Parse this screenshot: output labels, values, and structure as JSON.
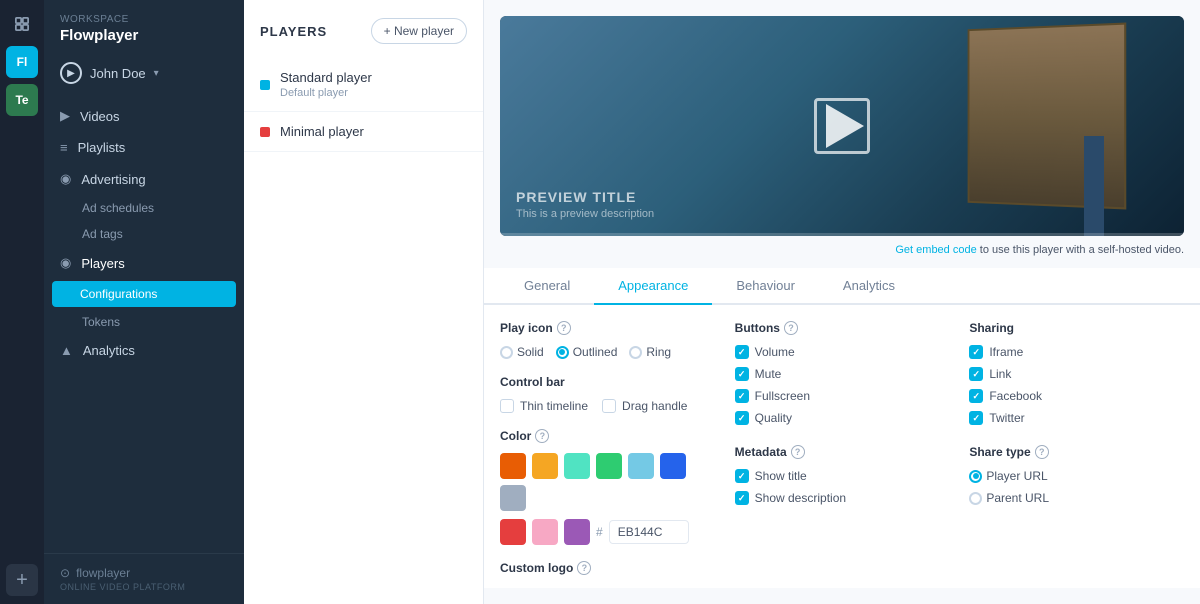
{
  "iconRail": {
    "items": [
      {
        "id": "grid",
        "label": "Grid icon",
        "active": false
      },
      {
        "id": "fl",
        "label": "FL workspace",
        "active": true,
        "text": "Fl"
      },
      {
        "id": "te",
        "label": "TE workspace",
        "active": false,
        "text": "Te"
      },
      {
        "id": "add",
        "label": "Add workspace",
        "active": false,
        "text": "+"
      }
    ]
  },
  "sidebar": {
    "workspace": "WORKSPACE",
    "brand": "Flowplayer",
    "user": {
      "name": "John Doe",
      "chevron": "▾"
    },
    "nav": [
      {
        "id": "videos",
        "label": "Videos",
        "icon": "▶"
      },
      {
        "id": "playlists",
        "label": "Playlists",
        "icon": "≡"
      },
      {
        "id": "advertising",
        "label": "Advertising",
        "icon": "◎",
        "sub": [
          {
            "id": "ad-schedules",
            "label": "Ad schedules"
          },
          {
            "id": "ad-tags",
            "label": "Ad tags"
          }
        ]
      },
      {
        "id": "players",
        "label": "Players",
        "icon": "◎",
        "activeParent": true,
        "sub": [
          {
            "id": "configurations",
            "label": "Configurations",
            "active": true
          },
          {
            "id": "tokens",
            "label": "Tokens"
          }
        ]
      },
      {
        "id": "analytics",
        "label": "Analytics",
        "icon": "▲"
      }
    ],
    "footer": {
      "logo": "⊙ flowplayer",
      "sub": "ONLINE VIDEO PLATFORM"
    }
  },
  "playersPanel": {
    "title": "PLAYERS",
    "newButton": "+ New player",
    "items": [
      {
        "id": "standard",
        "name": "Standard player",
        "sub": "Default player",
        "color": "blue"
      },
      {
        "id": "minimal",
        "name": "Minimal player",
        "sub": "",
        "color": "red"
      }
    ]
  },
  "preview": {
    "title": "PREVIEW TITLE",
    "description": "This is a preview description",
    "embedNote": "Get embed code",
    "embedNoteRest": " to use this player with a self-hosted video."
  },
  "tabs": [
    {
      "id": "general",
      "label": "General",
      "active": false
    },
    {
      "id": "appearance",
      "label": "Appearance",
      "active": true
    },
    {
      "id": "behaviour",
      "label": "Behaviour",
      "active": false
    },
    {
      "id": "analytics",
      "label": "Analytics",
      "active": false
    }
  ],
  "appearance": {
    "playIcon": {
      "title": "Play icon",
      "options": [
        {
          "id": "solid",
          "label": "Solid",
          "checked": false
        },
        {
          "id": "outlined",
          "label": "Outlined",
          "checked": true
        },
        {
          "id": "ring",
          "label": "Ring",
          "checked": false
        }
      ]
    },
    "controlBar": {
      "title": "Control bar",
      "options": [
        {
          "id": "thin-timeline",
          "label": "Thin timeline",
          "checked": false
        },
        {
          "id": "drag-handle",
          "label": "Drag handle",
          "checked": false
        }
      ]
    },
    "color": {
      "title": "Color",
      "swatches": [
        "#e85d04",
        "#f5a623",
        "#50e3c2",
        "#2ecc71",
        "#74c9e5",
        "#2563eb",
        "#a0aec0",
        "#e53e3e",
        "#f7a8c4",
        "#9b59b6"
      ],
      "hashSymbol": "#",
      "value": "EB144C"
    },
    "customLogo": {
      "title": "Custom logo"
    },
    "buttons": {
      "title": "Buttons",
      "options": [
        {
          "id": "volume",
          "label": "Volume",
          "checked": true
        },
        {
          "id": "mute",
          "label": "Mute",
          "checked": true
        },
        {
          "id": "fullscreen",
          "label": "Fullscreen",
          "checked": true
        },
        {
          "id": "quality",
          "label": "Quality",
          "checked": true
        }
      ]
    },
    "sharing": {
      "title": "Sharing",
      "options": [
        {
          "id": "iframe",
          "label": "Iframe",
          "checked": true
        },
        {
          "id": "link",
          "label": "Link",
          "checked": true
        },
        {
          "id": "facebook",
          "label": "Facebook",
          "checked": true
        },
        {
          "id": "twitter",
          "label": "Twitter",
          "checked": true
        }
      ]
    },
    "metadata": {
      "title": "Metadata",
      "options": [
        {
          "id": "show-title",
          "label": "Show title",
          "checked": true
        },
        {
          "id": "show-description",
          "label": "Show description",
          "checked": true
        }
      ]
    },
    "shareType": {
      "title": "Share type",
      "options": [
        {
          "id": "player-url",
          "label": "Player URL",
          "checked": true
        },
        {
          "id": "parent-url",
          "label": "Parent URL",
          "checked": false
        }
      ]
    }
  }
}
